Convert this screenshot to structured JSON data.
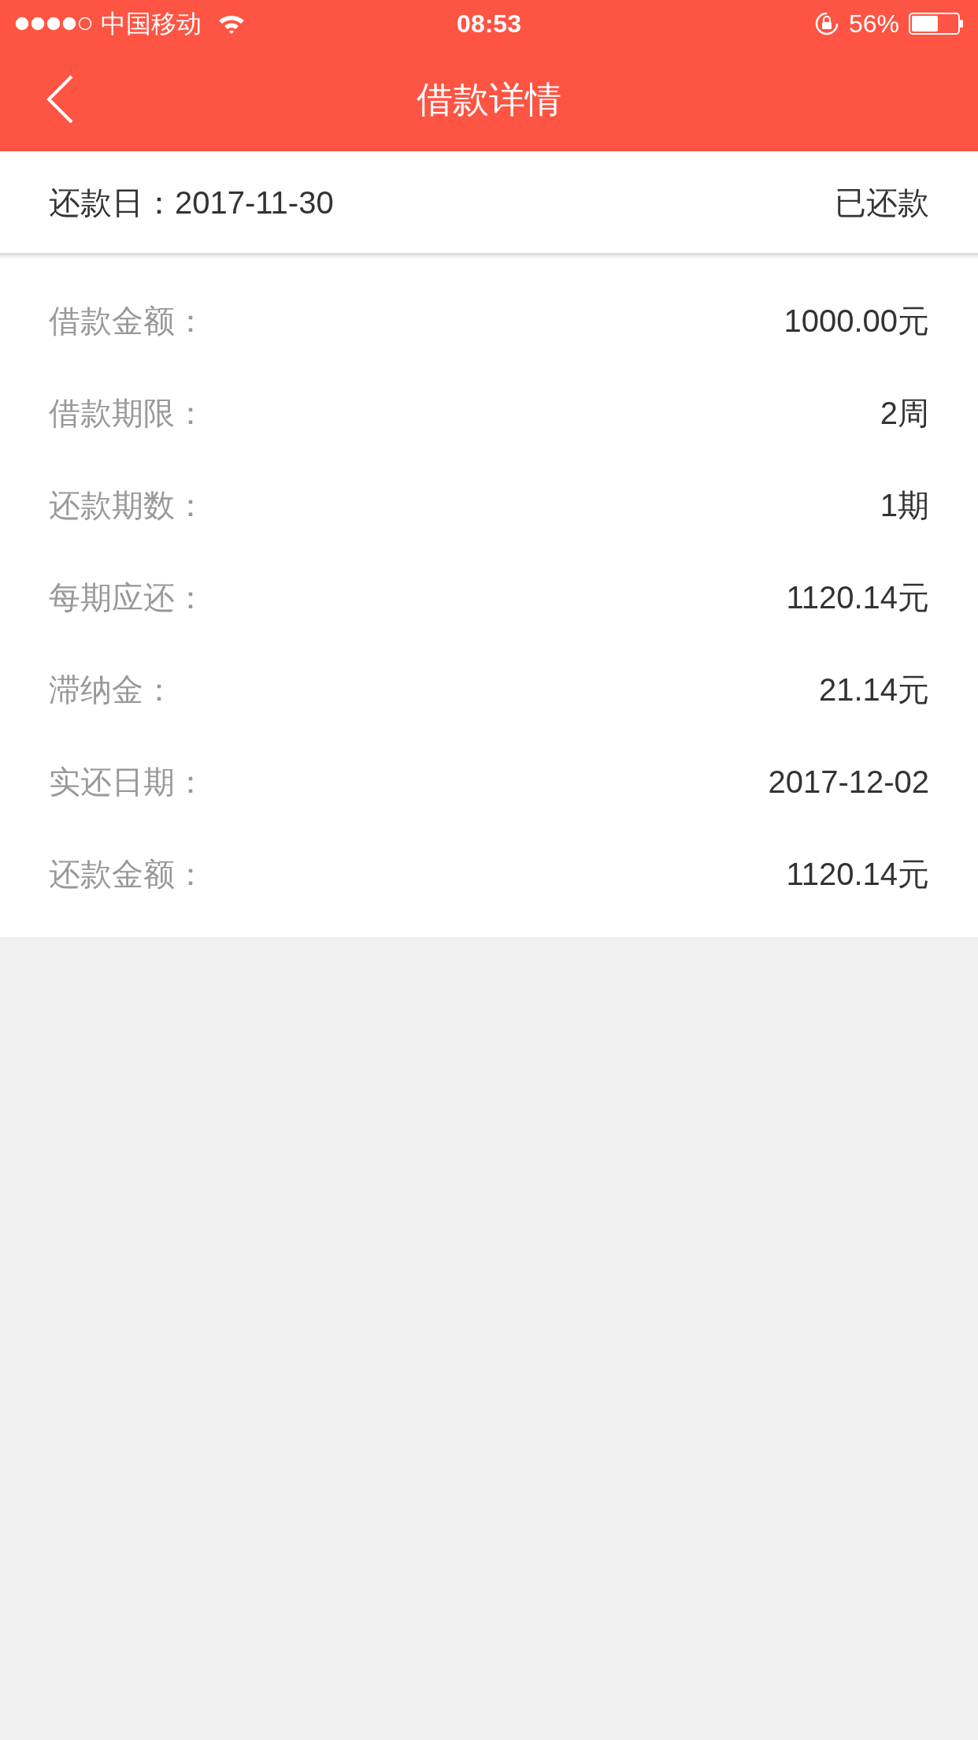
{
  "status_bar": {
    "carrier": "中国移动",
    "time": "08:53",
    "battery": "56%"
  },
  "nav": {
    "title": "借款详情"
  },
  "summary": {
    "label": "还款日：",
    "date": "2017-11-30",
    "status": "已还款"
  },
  "details": [
    {
      "label": "借款金额：",
      "value": "1000.00元"
    },
    {
      "label": "借款期限：",
      "value": "2周"
    },
    {
      "label": "还款期数：",
      "value": "1期"
    },
    {
      "label": "每期应还：",
      "value": "1120.14元"
    },
    {
      "label": "滞纳金：",
      "value": "21.14元"
    },
    {
      "label": "实还日期：",
      "value": "2017-12-02"
    },
    {
      "label": "还款金额：",
      "value": "1120.14元"
    }
  ]
}
